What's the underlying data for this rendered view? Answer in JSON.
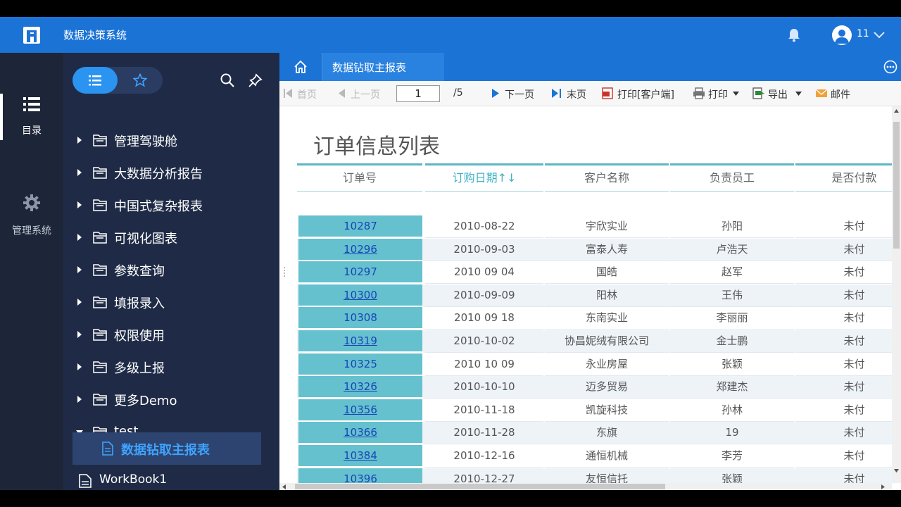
{
  "app": {
    "title": "数据决策系统",
    "user": "11"
  },
  "rail": {
    "items": [
      {
        "label": "目录",
        "icon": "list-icon"
      },
      {
        "label": "管理系统",
        "icon": "gear-icon"
      }
    ]
  },
  "tree": {
    "items": [
      {
        "label": "管理驾驶舱"
      },
      {
        "label": "大数据分析报告"
      },
      {
        "label": "中国式复杂报表"
      },
      {
        "label": "可视化图表"
      },
      {
        "label": "参数查询"
      },
      {
        "label": "填报录入"
      },
      {
        "label": "权限使用"
      },
      {
        "label": "多级上报"
      },
      {
        "label": "更多Demo"
      },
      {
        "label": "test"
      }
    ],
    "selected_child": "数据钻取主报表",
    "after_child": "WorkBook1"
  },
  "tabs": {
    "active": "数据钻取主报表"
  },
  "toolbar": {
    "first": "首页",
    "prev": "上一页",
    "page_value": "1",
    "page_total": "/5",
    "next": "下一页",
    "last": "末页",
    "print_client": "打印[客户端]",
    "print": "打印",
    "export": "导出",
    "mail": "邮件"
  },
  "report": {
    "title": "订单信息列表",
    "columns": [
      "订单号",
      "订购日期↑↓",
      "客户名称",
      "负责员工",
      "是否付款"
    ],
    "rows": [
      [
        "10287",
        "2010-08-22",
        "宇欣实业",
        "孙阳",
        "未付"
      ],
      [
        "10296",
        "2010-09-03",
        "富泰人寿",
        "卢浩天",
        "未付"
      ],
      [
        "10297",
        "2010 09 04",
        "国皓",
        "赵军",
        "未付"
      ],
      [
        "10300",
        "2010-09-09",
        "阳林",
        "王伟",
        "未付"
      ],
      [
        "10308",
        "2010 09 18",
        "东南实业",
        "李丽丽",
        "未付"
      ],
      [
        "10319",
        "2010-10-02",
        "协昌妮绒有限公司",
        "金士鹏",
        "未付"
      ],
      [
        "10325",
        "2010 10 09",
        "永业房屋",
        "张颖",
        "未付"
      ],
      [
        "10326",
        "2010-10-10",
        "迈多贸易",
        "郑建杰",
        "未付"
      ],
      [
        "10356",
        "2010-11-18",
        "凯旋科技",
        "孙林",
        "未付"
      ],
      [
        "10366",
        "2010-11-28",
        "东旗",
        "19",
        "未付"
      ],
      [
        "10384",
        "2010-12-16",
        "通恒机械",
        "李芳",
        "未付"
      ],
      [
        "10396",
        "2010-12-27",
        "友恒信托",
        "张颖",
        "未付"
      ]
    ]
  },
  "colors": {
    "header": "#1b73d6",
    "rail": "#1d2538",
    "tree": "#1f2b46",
    "id_cell": "#66c1cf",
    "accent": "#3fb1c4"
  }
}
